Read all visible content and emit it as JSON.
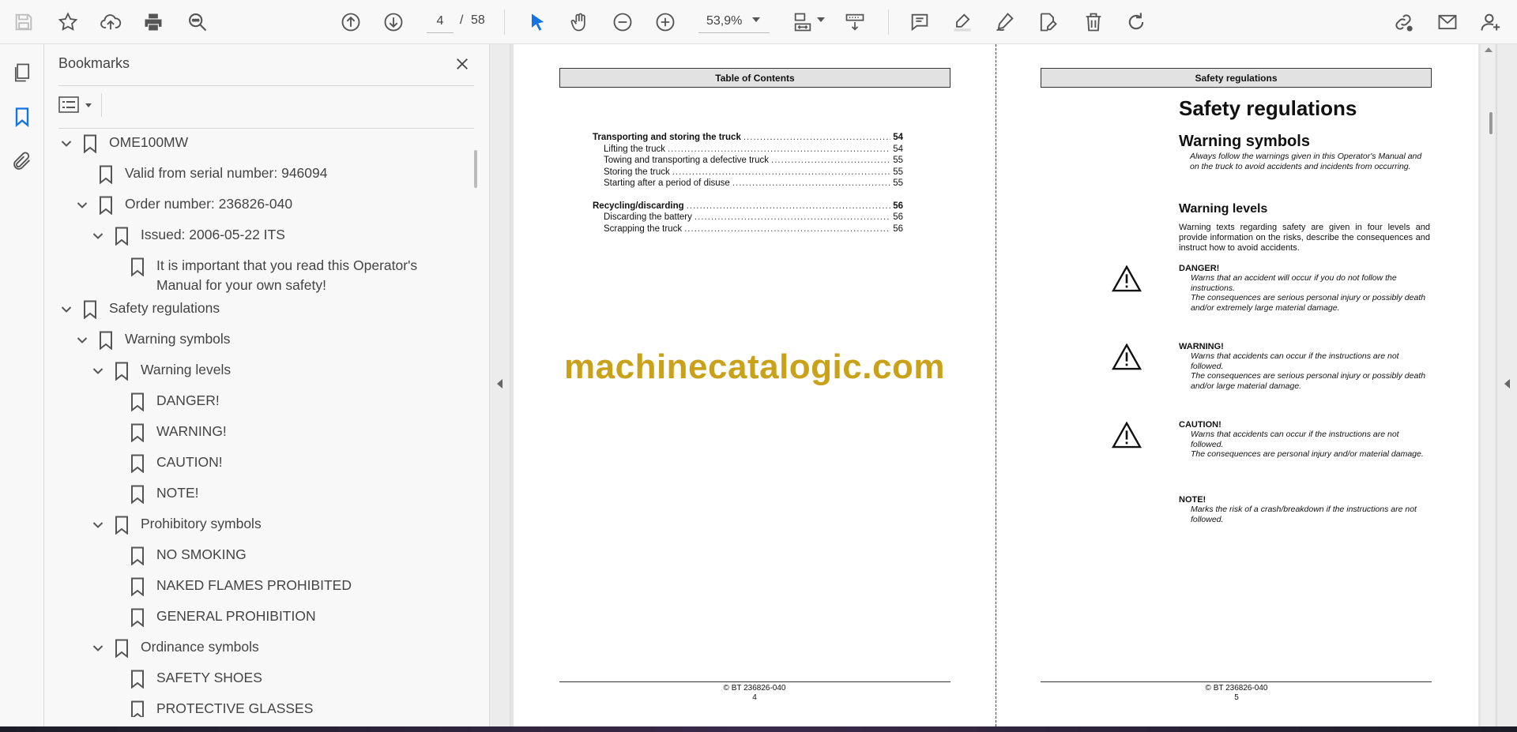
{
  "toolbar": {
    "page_current": "4",
    "page_slash": "/",
    "page_total": "58",
    "zoom": "53,9%",
    "icons": [
      "save-icon",
      "star-icon",
      "upload-icon",
      "print-icon",
      "find-icon",
      "page-up-icon",
      "page-down-icon",
      "select-cursor-icon",
      "hand-icon",
      "zoom-out-icon",
      "zoom-in-icon",
      "fit-page-icon",
      "scroll-mode-icon",
      "comment-icon",
      "highlight-icon",
      "draw-icon",
      "fill-sign-icon",
      "delete-icon",
      "rotate-icon",
      "share-link-icon",
      "email-icon",
      "account-icon"
    ],
    "accent": "#1473e6"
  },
  "rail": {
    "icons": [
      "pages-icon",
      "bookmark-icon",
      "attachment-icon"
    ]
  },
  "bookmarks": {
    "title": "Bookmarks",
    "items": [
      {
        "label": "OME100MW",
        "level": 0,
        "expandable": true
      },
      {
        "label": "Valid from serial number: 946094",
        "level": 1,
        "expandable": false
      },
      {
        "label": "Order number: 236826-040",
        "level": 1,
        "expandable": true
      },
      {
        "label": "Issued: 2006-05-22 ITS",
        "level": 2,
        "expandable": true
      },
      {
        "label": "It is important that you read this Operator's Manual for your own safety!",
        "level": 3,
        "expandable": false
      },
      {
        "label": "Safety regulations",
        "level": 0,
        "expandable": true
      },
      {
        "label": "Warning symbols",
        "level": 1,
        "expandable": true
      },
      {
        "label": "Warning levels",
        "level": 2,
        "expandable": true
      },
      {
        "label": "DANGER!",
        "level": 3,
        "expandable": false
      },
      {
        "label": "WARNING!",
        "level": 3,
        "expandable": false
      },
      {
        "label": "CAUTION!",
        "level": 3,
        "expandable": false
      },
      {
        "label": "NOTE!",
        "level": 3,
        "expandable": false
      },
      {
        "label": "Prohibitory symbols",
        "level": 2,
        "expandable": true
      },
      {
        "label": "NO SMOKING",
        "level": 3,
        "expandable": false
      },
      {
        "label": "NAKED FLAMES PROHIBITED",
        "level": 3,
        "expandable": false
      },
      {
        "label": "GENERAL PROHIBITION",
        "level": 3,
        "expandable": false
      },
      {
        "label": "Ordinance symbols",
        "level": 2,
        "expandable": true
      },
      {
        "label": "SAFETY SHOES",
        "level": 3,
        "expandable": false
      },
      {
        "label": "PROTECTIVE GLASSES",
        "level": 3,
        "expandable": false
      }
    ]
  },
  "left_page": {
    "header": "Table of Contents",
    "toc": [
      {
        "title": "Transporting and storing the truck",
        "page": "54",
        "bold": true
      },
      {
        "title": "Lifting the truck",
        "page": "54",
        "bold": false
      },
      {
        "title": "Towing and transporting a defective truck",
        "page": "55",
        "bold": false
      },
      {
        "title": "Storing the truck",
        "page": "55",
        "bold": false
      },
      {
        "title": "Starting after a period of disuse",
        "page": "55",
        "bold": false
      },
      {
        "title": "Recycling/discarding",
        "page": "56",
        "bold": true
      },
      {
        "title": "Discarding the battery",
        "page": "56",
        "bold": false
      },
      {
        "title": "Scrapping the truck",
        "page": "56",
        "bold": false
      }
    ],
    "watermark": "machinecatalogic.com",
    "footer_copyright": "© BT 236826-040",
    "footer_page": "4"
  },
  "right_page": {
    "header": "Safety regulations",
    "title": "Safety regulations",
    "subtitle": "Warning symbols",
    "intro": "Always follow the warnings given in this Operator's Manual and on the truck to avoid accidents and incidents from occurring.",
    "levels_heading": "Warning levels",
    "levels_body": "Warning texts regarding safety are given in four levels and provide information on the risks, describe the consequences and instruct how to avoid accidents.",
    "levels": [
      {
        "name": "DANGER!",
        "desc": "Warns that an accident will occur if you do not follow the instructions.",
        "desc2": "The consequences are serious personal injury or possibly death and/or extremely large material damage."
      },
      {
        "name": "WARNING!",
        "desc": "Warns that accidents can occur if the instructions are not followed.",
        "desc2": "The consequences are serious personal injury or possibly death and/or large material damage."
      },
      {
        "name": "CAUTION!",
        "desc": "Warns that accidents can occur if the instructions are not followed.",
        "desc2": "The consequences are personal injury and/or material damage."
      },
      {
        "name": "NOTE!",
        "desc": "Marks the risk of a crash/breakdown if the instructions are not followed.",
        "desc2": ""
      }
    ],
    "footer_copyright": "© BT 236826-040",
    "footer_page": "5"
  }
}
